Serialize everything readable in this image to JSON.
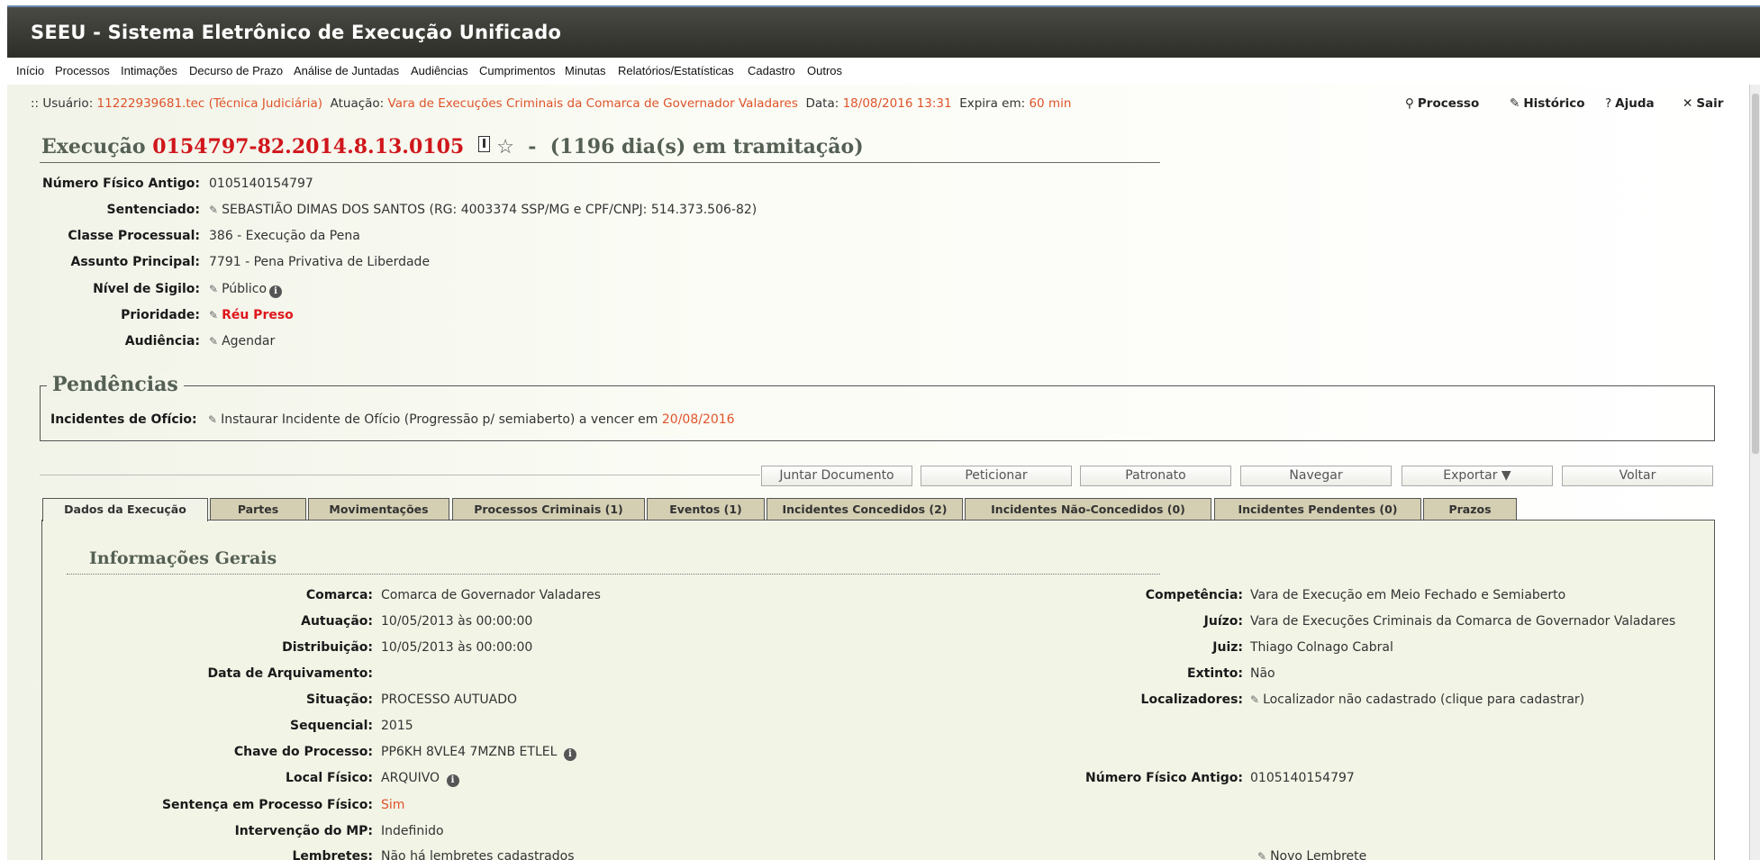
{
  "app": {
    "title": "SEEU - Sistema Eletrônico de Execução Unificado"
  },
  "menu": [
    "Início",
    "Processos",
    "Intimações",
    "Decurso de Prazo",
    "Análise de Juntadas",
    "Audiências",
    "Cumprimentos",
    "Minutas",
    "Relatórios/Estatísticas",
    "Cadastro",
    "Outros"
  ],
  "session": {
    "prefix": ":: Usuário:",
    "user": "11222939681.tec (Técnica Judiciária)",
    "atuacao_label": "Atuação:",
    "atuacao": "Vara de Execuções Criminais da Comarca de Governador Valadares",
    "data_label": "Data:",
    "data": "18/08/2016 13:31",
    "expira_label": "Expira em:",
    "expira": "60 min"
  },
  "toplinks": {
    "processo": "Processo",
    "historico": "Histórico",
    "ajuda": "Ajuda",
    "sair": "Sair"
  },
  "execucao": {
    "label": "Execução",
    "numero": "0154797-82.2014.8.13.0105",
    "separator": "-",
    "tramitacao": "(1196 dia(s) em tramitação)"
  },
  "fields": [
    {
      "label": "Número Físico Antigo:",
      "value": "0105140154797"
    },
    {
      "label": "Sentenciado:",
      "value": "SEBASTIÃO DIMAS DOS SANTOS (RG: 4003374 SSP/MG e CPF/CNPJ: 514.373.506-82)"
    },
    {
      "label": "Classe Processual:",
      "value": "386 - Execução da Pena"
    },
    {
      "label": "Assunto Principal:",
      "value": "7791 - Pena Privativa de Liberdade"
    },
    {
      "label": "Nível de Sigilo:",
      "value": "Público"
    },
    {
      "label": "Prioridade:",
      "value": "Réu Preso"
    },
    {
      "label": "Audiência:",
      "value": "Agendar"
    }
  ],
  "pendencias": {
    "title": "Pendências",
    "label": "Incidentes de Ofício:",
    "text": "Instaurar Incidente de Ofício (Progressão p/ semiaberto) a vencer em",
    "date": "20/08/2016"
  },
  "buttons": [
    "Juntar Documento",
    "Peticionar",
    "Patronato",
    "Navegar",
    "Exportar ▼",
    "Voltar"
  ],
  "tabs": [
    "Dados da Execução",
    "Partes",
    "Movimentações",
    "Processos Criminais (1)",
    "Eventos (1)",
    "Incidentes Concedidos (2)",
    "Incidentes Não-Concedidos (0)",
    "Incidentes Pendentes (0)",
    "Prazos"
  ],
  "info_gerais": {
    "title": "Informações Gerais",
    "left": [
      {
        "label": "Comarca:",
        "value": "Comarca de Governador Valadares"
      },
      {
        "label": "Autuação:",
        "value": "10/05/2013 às 00:00:00"
      },
      {
        "label": "Distribuição:",
        "value": "10/05/2013 às 00:00:00"
      },
      {
        "label": "Data de Arquivamento:",
        "value": ""
      },
      {
        "label": "Situação:",
        "value": "PROCESSO AUTUADO"
      },
      {
        "label": "Sequencial:",
        "value": "2015"
      },
      {
        "label": "Chave do Processo:",
        "value": "PP6KH 8VLE4 7MZNB ETLEL"
      },
      {
        "label": "Local Físico:",
        "value": "ARQUIVO"
      },
      {
        "label": "Sentença em Processo Físico:",
        "value": "Sim"
      },
      {
        "label": "Intervenção do MP:",
        "value": "Indefinido"
      },
      {
        "label": "Lembretes:",
        "value": "Não há lembretes cadastrados"
      }
    ],
    "right": [
      {
        "label": "Competência:",
        "value": "Vara de Execução em Meio Fechado e Semiaberto"
      },
      {
        "label": "Juízo:",
        "value": "Vara de Execuções Criminais da Comarca de Governador Valadares"
      },
      {
        "label": "Juiz:",
        "value": "Thiago Colnago Cabral"
      },
      {
        "label": "Extinto:",
        "value": "Não"
      },
      {
        "label": "Localizadores:",
        "value": "Localizador não cadastrado (clique para cadastrar)"
      },
      {
        "label": "Número Físico Antigo:",
        "value": "0105140154797"
      }
    ],
    "novo_lembrete": "Novo Lembrete"
  },
  "colors": {
    "accent_red": "#d0161b",
    "accent_orange": "#e0532a",
    "heading_green": "#556054",
    "tab_bg": "#d4cfb2"
  }
}
